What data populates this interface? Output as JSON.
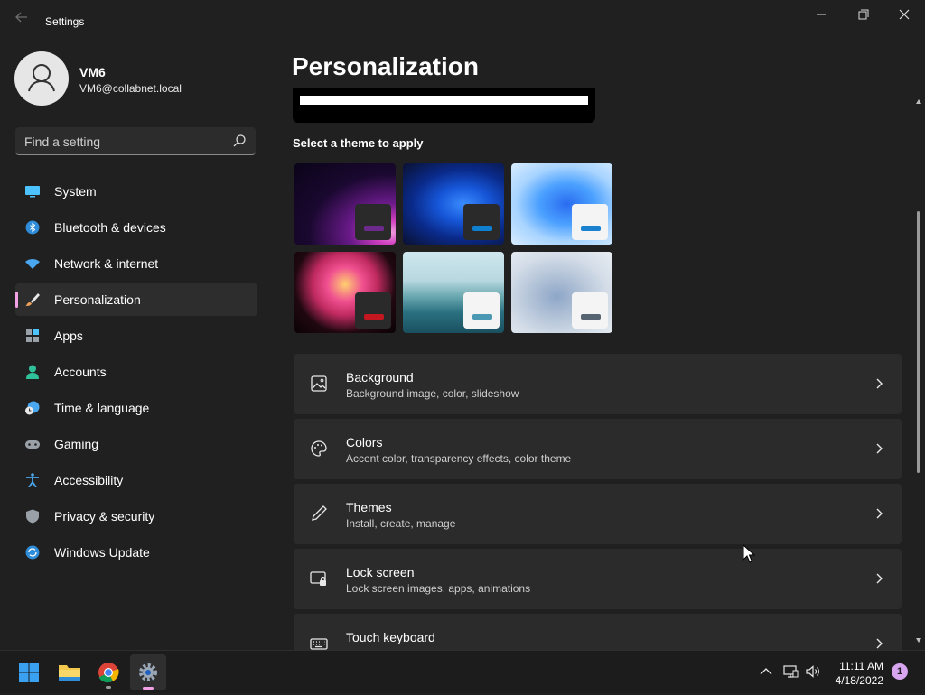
{
  "window": {
    "app_title": "Settings",
    "back_icon": "back-arrow-icon",
    "controls": [
      "minimize-icon",
      "maximize-icon",
      "close-icon"
    ]
  },
  "user": {
    "name": "VM6",
    "email": "VM6@collabnet.local",
    "avatar_icon": "person-icon"
  },
  "search": {
    "placeholder": "Find a setting",
    "icon": "search-icon"
  },
  "sidebar": {
    "selected": "Personalization",
    "items": [
      {
        "label": "System",
        "icon": "monitor-icon"
      },
      {
        "label": "Bluetooth & devices",
        "icon": "bluetooth-icon"
      },
      {
        "label": "Network & internet",
        "icon": "wifi-icon"
      },
      {
        "label": "Personalization",
        "icon": "brush-icon"
      },
      {
        "label": "Apps",
        "icon": "apps-icon"
      },
      {
        "label": "Accounts",
        "icon": "accounts-icon"
      },
      {
        "label": "Time & language",
        "icon": "clock-globe-icon"
      },
      {
        "label": "Gaming",
        "icon": "gamepad-icon"
      },
      {
        "label": "Accessibility",
        "icon": "accessibility-icon"
      },
      {
        "label": "Privacy & security",
        "icon": "shield-icon"
      },
      {
        "label": "Windows Update",
        "icon": "update-icon"
      }
    ]
  },
  "main": {
    "title": "Personalization",
    "themes_label": "Select a theme to apply",
    "themes": [
      {
        "name": "glow-dark",
        "swatch": "#6b2a8c"
      },
      {
        "name": "bloom-dark",
        "swatch": "#0f7fcf"
      },
      {
        "name": "bloom-light",
        "swatch": "#1a80d0"
      },
      {
        "name": "captured-motion",
        "swatch": "#c4171f"
      },
      {
        "name": "sunrise",
        "swatch": "#4a98b3"
      },
      {
        "name": "flow",
        "swatch": "#566370"
      }
    ],
    "settings": [
      {
        "title": "Background",
        "subtitle": "Background image, color, slideshow",
        "icon": "picture-icon"
      },
      {
        "title": "Colors",
        "subtitle": "Accent color, transparency effects, color theme",
        "icon": "palette-icon"
      },
      {
        "title": "Themes",
        "subtitle": "Install, create, manage",
        "icon": "pen-icon"
      },
      {
        "title": "Lock screen",
        "subtitle": "Lock screen images, apps, animations",
        "icon": "lock-screen-icon"
      },
      {
        "title": "Touch keyboard",
        "subtitle": "",
        "icon": "keyboard-icon"
      }
    ]
  },
  "taskbar": {
    "apps": [
      "windows-start-icon",
      "file-explorer-icon",
      "chrome-icon",
      "settings-icon"
    ],
    "tray": [
      "chevron-up-icon",
      "network-icon",
      "volume-icon"
    ],
    "time": "11:11 AM",
    "date": "4/18/2022",
    "notification_count": "1"
  },
  "colors": {
    "accent": "#f2a1e6",
    "background": "#202020",
    "card": "#2b2b2b"
  }
}
